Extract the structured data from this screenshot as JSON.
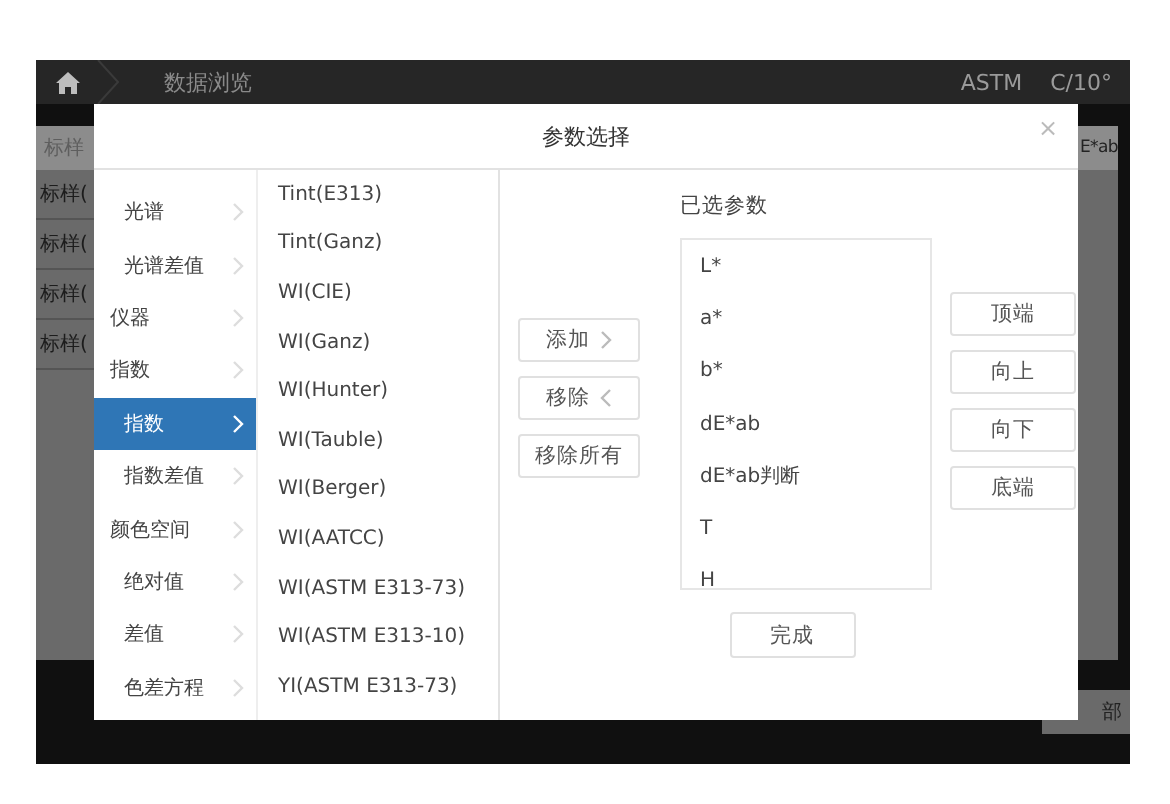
{
  "top_bar": {
    "breadcrumb": "数据浏览",
    "standard": "ASTM",
    "observer": "C/10°"
  },
  "background_table": {
    "header": "标样",
    "header_right": "E*ab",
    "rows": [
      "标样(",
      "标样(",
      "标样(",
      "标样("
    ],
    "button": "部"
  },
  "dialog": {
    "title": "参数选择",
    "close": "×",
    "categories": [
      {
        "children": [
          {
            "label": "光谱",
            "selected": false
          },
          {
            "label": "光谱差值",
            "selected": false
          }
        ]
      },
      {
        "label": "仪器",
        "selected": false
      },
      {
        "label": "指数",
        "selected": false,
        "children": [
          {
            "label": "指数",
            "selected": true
          },
          {
            "label": "指数差值",
            "selected": false
          }
        ]
      },
      {
        "label": "颜色空间",
        "selected": false,
        "children": [
          {
            "label": "绝对值",
            "selected": false
          },
          {
            "label": "差值",
            "selected": false
          },
          {
            "label": "色差方程",
            "selected": false
          }
        ]
      }
    ],
    "parameters": [
      "Tint(E313)",
      "Tint(Ganz)",
      "WI(CIE)",
      "WI(Ganz)",
      "WI(Hunter)",
      "WI(Tauble)",
      "WI(Berger)",
      "WI(AATCC)",
      "WI(ASTM E313-73)",
      "WI(ASTM E313-10)",
      "YI(ASTM E313-73)"
    ],
    "selected_label": "已选参数",
    "selected_params": [
      "L*",
      "a*",
      "b*",
      "dE*ab",
      "dE*ab判断",
      "T",
      "H"
    ],
    "transfer_buttons": [
      {
        "label": "添加",
        "kind": "add"
      },
      {
        "label": "移除",
        "kind": "remove"
      },
      {
        "label": "移除所有",
        "kind": "plain"
      }
    ],
    "order_buttons": [
      "顶端",
      "向上",
      "向下",
      "底端"
    ],
    "done": "完成"
  }
}
